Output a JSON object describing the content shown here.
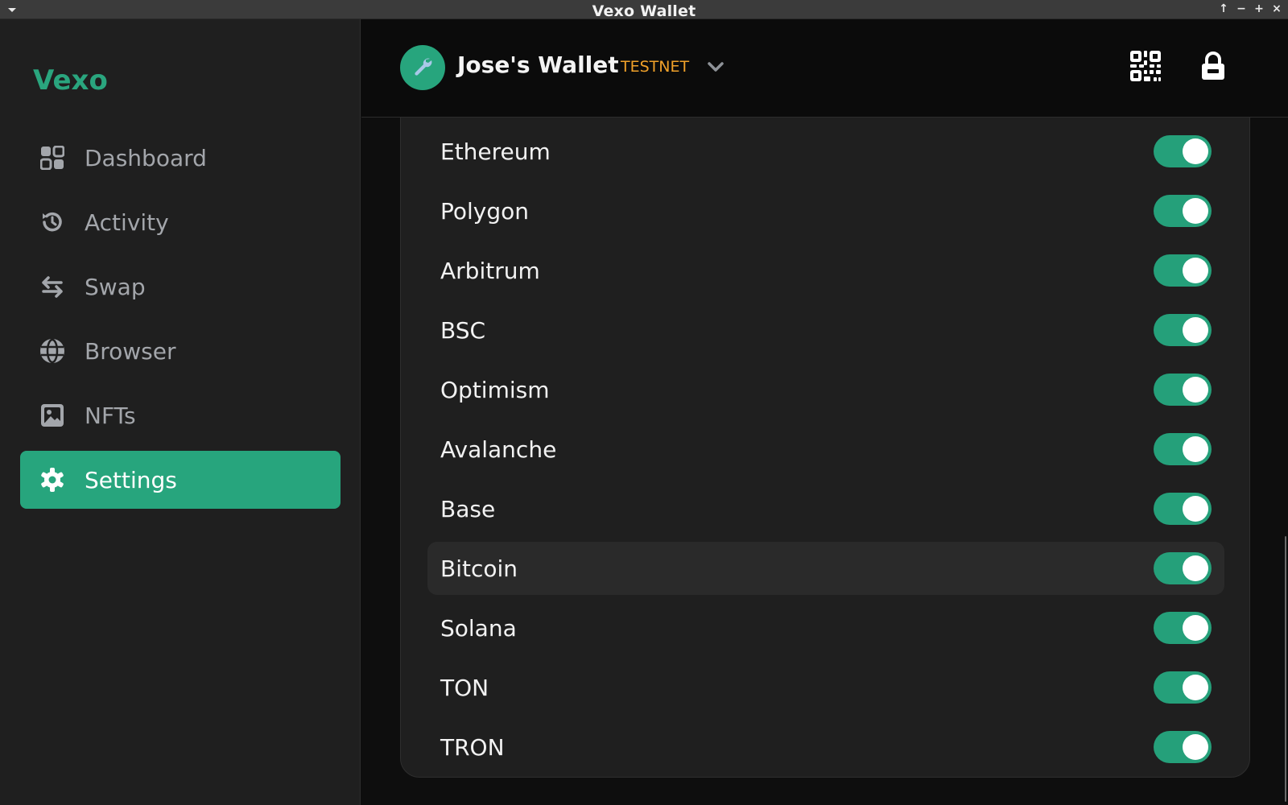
{
  "window": {
    "title": "Vexo Wallet"
  },
  "sidebar": {
    "brand": "Vexo",
    "items": [
      {
        "label": "Dashboard",
        "icon": "dashboard-icon",
        "active": false
      },
      {
        "label": "Activity",
        "icon": "history-icon",
        "active": false
      },
      {
        "label": "Swap",
        "icon": "swap-icon",
        "active": false
      },
      {
        "label": "Browser",
        "icon": "globe-icon",
        "active": false
      },
      {
        "label": "NFTs",
        "icon": "image-icon",
        "active": false
      },
      {
        "label": "Settings",
        "icon": "gear-icon",
        "active": true
      }
    ]
  },
  "header": {
    "wallet_name": "Jose's Wallet",
    "network": "TESTNET",
    "avatar_icon": "wrench-icon",
    "actions": [
      "qr-code-icon",
      "lock-icon"
    ]
  },
  "chains": [
    {
      "name": "Ethereum",
      "enabled": true
    },
    {
      "name": "Polygon",
      "enabled": true
    },
    {
      "name": "Arbitrum",
      "enabled": true
    },
    {
      "name": "BSC",
      "enabled": true
    },
    {
      "name": "Optimism",
      "enabled": true
    },
    {
      "name": "Avalanche",
      "enabled": true
    },
    {
      "name": "Base",
      "enabled": true
    },
    {
      "name": "Bitcoin",
      "enabled": true,
      "hovered": true
    },
    {
      "name": "Solana",
      "enabled": true
    },
    {
      "name": "TON",
      "enabled": true
    },
    {
      "name": "TRON",
      "enabled": true
    }
  ],
  "colors": {
    "accent": "#27a57d",
    "network": "#f0a12a",
    "sidebar_bg": "#1f1f1f",
    "content_bg": "#0e0e0e"
  }
}
